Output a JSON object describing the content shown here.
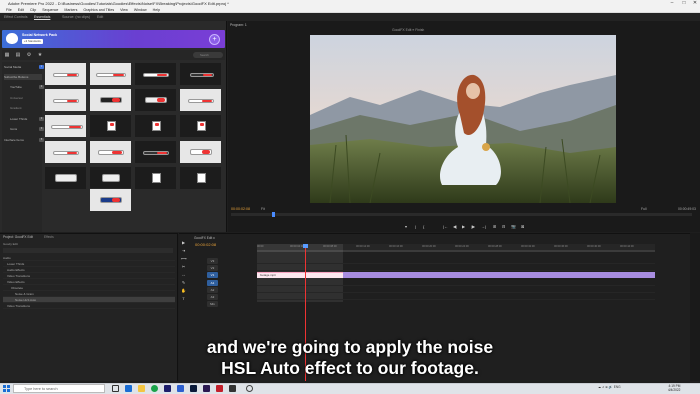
{
  "window": {
    "title": "Adobe Premiere Pro 2022 - D:\\Business\\Goodies\\Tutorials\\Goodies\\Effects\\Noise\\FX\\Breaking\\Projects\\GoodFX Edit.prproj *",
    "controls": {
      "min": "–",
      "max": "□",
      "close": "✕"
    }
  },
  "menu": [
    "File",
    "Edit",
    "Clip",
    "Sequence",
    "Markers",
    "Graphics and Titles",
    "View",
    "Window",
    "Help"
  ],
  "workspaces": {
    "left": "Effect Controls",
    "active": "Essentials",
    "mid": "Source: (no clips)",
    "right": "Edit",
    "extra": "Audio"
  },
  "left_panel": {
    "tabs": [
      "Effect Controls",
      "Essentials",
      "Source: (no clips)",
      "Edit"
    ],
    "banner": {
      "title": "Social Network Pack",
      "pill": "+3 Standards",
      "plus": "+"
    },
    "search_placeholder": "Search",
    "sidebar": [
      {
        "label": "Social Media",
        "badge": "1"
      },
      {
        "label": "Subscribe Buttons",
        "badge": "",
        "selected": true
      },
      {
        "label": "YouTube",
        "badge": "4"
      },
      {
        "label": "Universal",
        "badge": ""
      },
      {
        "label": "Gradient",
        "badge": ""
      },
      {
        "label": "Lower Thirds",
        "badge": "4"
      },
      {
        "label": "Icons",
        "badge": "3"
      },
      {
        "label": "Interface Items",
        "badge": "5"
      }
    ]
  },
  "program": {
    "tab": "Program: 1",
    "sequence_title": "GoodFX Edit ≡ Finish",
    "timecode": "00:00:02:08",
    "fit": "Fit",
    "quality": "Full",
    "duration": "00:00:49:03",
    "transport": [
      "▾",
      "|",
      "{",
      "}",
      "|←",
      "◀|",
      "▶",
      "|▶",
      "→|",
      "⊞",
      "⊟",
      "📷",
      "⊠"
    ]
  },
  "project": {
    "tab": "Project: GoodFX Edit",
    "tab2": "Effects",
    "path": "Goody Edit",
    "rows": [
      {
        "label": "Audio",
        "selected": false
      },
      {
        "label": "Lower Thirds",
        "selected": false
      },
      {
        "label": "Audio Effects",
        "selected": false
      },
      {
        "label": "Video Transitions",
        "selected": false
      },
      {
        "label": "Video Effects",
        "selected": false
      },
      {
        "label": "Obsolete",
        "selected": false
      },
      {
        "label": "Noise & Grain",
        "selected": false
      },
      {
        "label": "Noise HLS Auto",
        "selected": true
      },
      {
        "label": "Video Transitions",
        "selected": false
      }
    ]
  },
  "timeline": {
    "tab": "GoodFX Edit ≡",
    "timecode": "00:00:02:08",
    "clip_label": "footage.mp4",
    "tracks": [
      "V3",
      "V2",
      "V1",
      "A1",
      "A2",
      "A3",
      "Mix"
    ],
    "ruler": [
      "00:00",
      "00:00:04:00",
      "00:00:08:00",
      "00:00:12:00",
      "00:00:16:00",
      "00:00:20:00",
      "00:00:24:00",
      "00:00:28:00",
      "00:00:32:00",
      "00:00:36:00",
      "00:00:40:00",
      "00:00:44:00"
    ]
  },
  "caption": {
    "line1": "and we're going to apply the noise",
    "line2": "HSL Auto effect to our footage."
  },
  "taskbar": {
    "search": "Type here to search",
    "tray": "☁ ∧ ⊕ 🔊 ENG",
    "time": "4:19 PM",
    "date": "4/4/2022"
  },
  "colors": {
    "accent_purple": "#7a3ed6",
    "timecode": "#e8a23a",
    "playhead": "#e33333",
    "clip": "#a88de0"
  }
}
